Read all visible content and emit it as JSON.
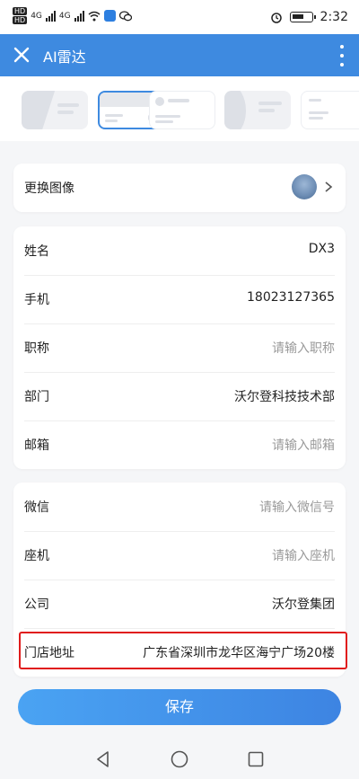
{
  "status_bar": {
    "hd1": "HD",
    "hd2": "HD",
    "net1": "4G",
    "net2": "4G",
    "time": "2:32"
  },
  "header": {
    "title": "AI雷达"
  },
  "profile": {
    "change_image_label": "更换图像"
  },
  "basic_info": [
    {
      "label": "姓名",
      "value": "DX3",
      "placeholder": false
    },
    {
      "label": "手机",
      "value": "18023127365",
      "placeholder": false
    },
    {
      "label": "职称",
      "value": "请输入职称",
      "placeholder": true
    },
    {
      "label": "部门",
      "value": "沃尔登科技技术部",
      "placeholder": false
    },
    {
      "label": "邮箱",
      "value": "请输入邮箱",
      "placeholder": true
    }
  ],
  "extra_info": [
    {
      "label": "微信",
      "value": "请输入微信号",
      "placeholder": true
    },
    {
      "label": "座机",
      "value": "请输入座机",
      "placeholder": true
    },
    {
      "label": "公司",
      "value": "沃尔登集团",
      "placeholder": false
    },
    {
      "label": "门店地址",
      "value": "广东省深圳市龙华区海宁广场20楼",
      "placeholder": false
    }
  ],
  "save_label": "保存",
  "colors": {
    "accent": "#3e8ae0",
    "highlight": "#e01b1b"
  }
}
